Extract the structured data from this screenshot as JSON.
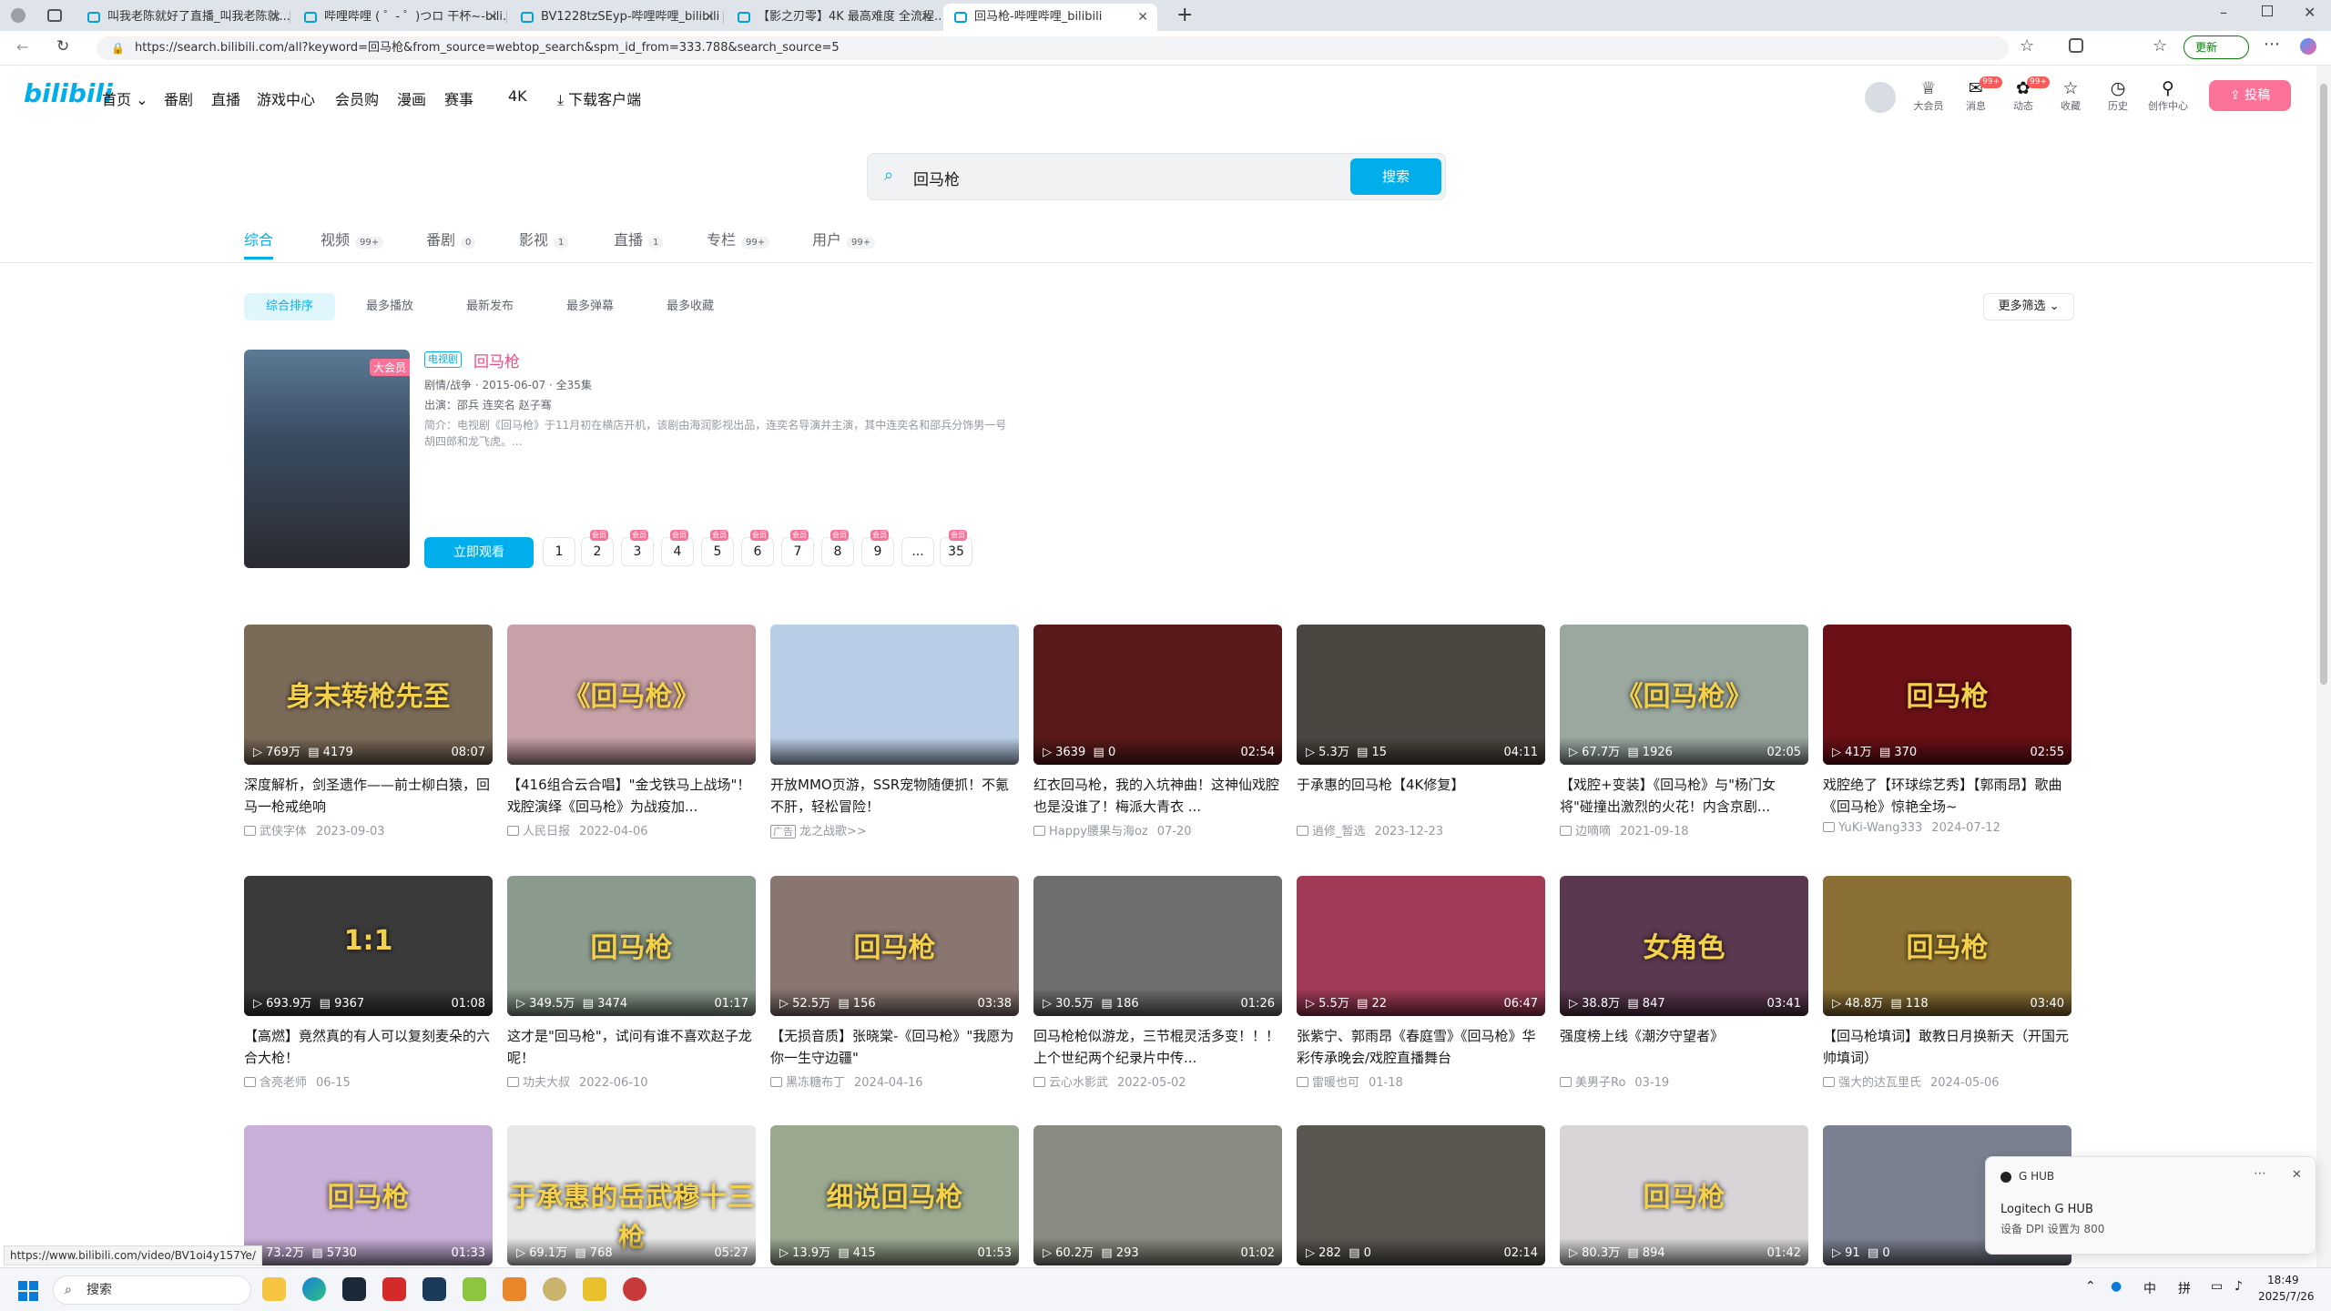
{
  "browser": {
    "tabs": [
      {
        "title": "叫我老陈就好了直播_叫我老陈就..."
      },
      {
        "title": "哔哩哔哩 ( ゜- ゜)つロ 干杯~-bili..."
      },
      {
        "title": "BV1228tzSEyp-哔哩哔哩_bilibili"
      },
      {
        "title": "【影之刃零】4K 最高难度 全流程..."
      },
      {
        "title": "回马枪-哔哩哔哩_bilibili"
      }
    ],
    "url": "https://search.bilibili.com/all?keyword=回马枪&from_source=webtop_search&spm_id_from=333.788&search_source=5",
    "update_label": "更新",
    "status_url": "https://www.bilibili.com/video/BV1oi4y157Ye/"
  },
  "header": {
    "logo": "bilibili",
    "nav": [
      "首页",
      "番剧",
      "直播",
      "游戏中心",
      "会员购",
      "漫画",
      "赛事",
      "4K",
      "下载客户端"
    ],
    "right": [
      {
        "icon": "vip-icon",
        "label": "大会员"
      },
      {
        "icon": "message-icon",
        "label": "消息",
        "badge": "99+"
      },
      {
        "icon": "dynamic-icon",
        "label": "动态",
        "badge": "99+"
      },
      {
        "icon": "star-icon",
        "label": "收藏"
      },
      {
        "icon": "clock-icon",
        "label": "历史"
      },
      {
        "icon": "bulb-icon",
        "label": "创作中心"
      }
    ],
    "upload": "投稿"
  },
  "search": {
    "query": "回马枪",
    "button": "搜索"
  },
  "type_tabs": [
    {
      "label": "综合",
      "count": ""
    },
    {
      "label": "视频",
      "count": "99+"
    },
    {
      "label": "番剧",
      "count": "0"
    },
    {
      "label": "影视",
      "count": "1"
    },
    {
      "label": "直播",
      "count": "1"
    },
    {
      "label": "专栏",
      "count": "99+"
    },
    {
      "label": "用户",
      "count": "99+"
    }
  ],
  "sorts": [
    "综合排序",
    "最多播放",
    "最新发布",
    "最多弹幕",
    "最多收藏"
  ],
  "more_filter": "更多筛选",
  "media": {
    "tag": "电视剧",
    "title": "回马枪",
    "vip": "大会员",
    "info": "剧情/战争 · 2015-06-07 · 全35集",
    "cast": "出演：邵兵 连奕名 赵子骞",
    "desc": "简介：电视剧《回马枪》于11月初在横店开机，该剧由海润影视出品，连奕名导演并主演，其中连奕名和邵兵分饰男一号胡四郎和龙飞虎。...",
    "watch": "立即观看",
    "eps": [
      "1",
      "2",
      "3",
      "4",
      "5",
      "6",
      "7",
      "8",
      "9",
      "...",
      "35"
    ],
    "vipmark": "会员"
  },
  "videos": [
    {
      "title": "深度解析，剑圣遗作——前士柳白猿，回马一枪戒绝响",
      "play": "769万",
      "dm": "4179",
      "dur": "08:07",
      "up": "武侠字体",
      "date": "2023-09-03",
      "overlay": "身末转枪先至",
      "bg": "#7a6a58"
    },
    {
      "title": "【416组合云合唱】\"金戈铁马上战场\"！戏腔演绎《回马枪》为战疫加...",
      "play": "",
      "dm": "",
      "dur": "",
      "up": "人民日报",
      "date": "2022-04-06",
      "overlay": "《回马枪》",
      "bg": "#c8a0a8"
    },
    {
      "title": "开放MMO页游，SSR宠物随便抓！不氪不肝，轻松冒险！",
      "play": "",
      "dm": "",
      "dur": "",
      "up": "龙之战歌>>",
      "date": "",
      "ad": "广告",
      "overlay": "",
      "bg": "#b9cde6"
    },
    {
      "title": "红衣回马枪，我的入坑神曲！这神仙戏腔也是没谁了！梅派大青衣 ...",
      "play": "3639",
      "dm": "0",
      "dur": "02:54",
      "up": "Happy腰果与海oz",
      "date": "07-20",
      "overlay": "",
      "bg": "#5a1a1a"
    },
    {
      "title": "于承惠的回马枪【4K修复】",
      "play": "5.3万",
      "dm": "15",
      "dur": "04:11",
      "up": "逍修_暂选",
      "date": "2023-12-23",
      "overlay": "",
      "bg": "#4a4640"
    },
    {
      "title": "【戏腔+变装】《回马枪》与\"杨门女将\"碰撞出激烈的火花！内含京剧...",
      "play": "67.7万",
      "dm": "1926",
      "dur": "02:05",
      "up": "边嘀嘀",
      "date": "2021-09-18",
      "overlay": "《回马枪》",
      "bg": "#9aa8a0"
    },
    {
      "title": "戏腔绝了【环球综艺秀】【郭雨昂】歌曲《回马枪》惊艳全场~",
      "play": "41万",
      "dm": "370",
      "dur": "02:55",
      "up": "YuKi-Wang333",
      "date": "2024-07-12",
      "overlay": "回马枪",
      "bg": "#6a1016"
    },
    {
      "title": "【高燃】竟然真的有人可以复刻麦朵的六合大枪！",
      "play": "693.9万",
      "dm": "9367",
      "dur": "01:08",
      "up": "含亮老师",
      "date": "06-15",
      "overlay": "1:1",
      "bg": "#3a3a3a"
    },
    {
      "title": "这才是\"回马枪\"，试问有谁不喜欢赵子龙呢！",
      "play": "349.5万",
      "dm": "3474",
      "dur": "01:17",
      "up": "功夫大叔",
      "date": "2022-06-10",
      "overlay": "回马枪",
      "bg": "#8a9a8c"
    },
    {
      "title": "【无损音质】张晓棠-《回马枪》\"我愿为你一生守边疆\"",
      "play": "52.5万",
      "dm": "156",
      "dur": "03:38",
      "up": "黑冻糖布丁",
      "date": "2024-04-16",
      "overlay": "回马枪",
      "bg": "#8a7670"
    },
    {
      "title": "回马枪枪似游龙，三节棍灵活多变！！！上个世纪两个纪录片中传...",
      "play": "30.5万",
      "dm": "186",
      "dur": "01:26",
      "up": "云心水影武",
      "date": "2022-05-02",
      "overlay": "",
      "bg": "#6e6e6e"
    },
    {
      "title": "张紫宁、郭雨昂《春庭雪》《回马枪》华彩传承晚会/戏腔直播舞台",
      "play": "5.5万",
      "dm": "22",
      "dur": "06:47",
      "up": "雷暖也可",
      "date": "01-18",
      "overlay": "",
      "bg": "#a03a56"
    },
    {
      "title": "强度榜上线《潮汐守望者》",
      "play": "38.8万",
      "dm": "847",
      "dur": "03:41",
      "up": "美男子Ro",
      "date": "03-19",
      "overlay": "女角色",
      "bg": "#5a3850"
    },
    {
      "title": "【回马枪填词】敢教日月换新天（开国元帅填词）",
      "play": "48.8万",
      "dm": "118",
      "dur": "03:40",
      "up": "强大的达瓦里氏",
      "date": "2024-05-06",
      "overlay": "回马枪",
      "bg": "#8a7034"
    },
    {
      "title": "",
      "play": "73.2万",
      "dm": "5730",
      "dur": "01:33",
      "up": "",
      "date": "",
      "overlay": "回马枪",
      "bg": "#c8b0d8"
    },
    {
      "title": "",
      "play": "69.1万",
      "dm": "768",
      "dur": "05:27",
      "up": "",
      "date": "",
      "overlay": "于承惠的岳武穆十三枪",
      "bg": "#e8e8e8"
    },
    {
      "title": "",
      "play": "13.9万",
      "dm": "415",
      "dur": "01:53",
      "up": "",
      "date": "",
      "overlay": "细说回马枪",
      "bg": "#9aa890"
    },
    {
      "title": "",
      "play": "60.2万",
      "dm": "293",
      "dur": "01:02",
      "up": "",
      "date": "",
      "overlay": "",
      "bg": "#8a8a80"
    },
    {
      "title": "",
      "play": "282",
      "dm": "0",
      "dur": "02:14",
      "up": "",
      "date": "",
      "overlay": "",
      "bg": "#5a5650"
    },
    {
      "title": "",
      "play": "80.3万",
      "dm": "894",
      "dur": "01:42",
      "up": "",
      "date": "",
      "overlay": "回马枪",
      "bg": "#d8d4d8"
    },
    {
      "title": "",
      "play": "91",
      "dm": "0",
      "dur": "",
      "up": "",
      "date": "",
      "overlay": "",
      "bg": "#7a8090"
    }
  ],
  "toast": {
    "app": "G HUB",
    "title": "Logitech G HUB",
    "body": "设备 DPI 设置为 800"
  },
  "taskbar": {
    "search": "搜索",
    "time": "18:49",
    "date": "2025/7/26",
    "ime": "中",
    "ime2": "拼"
  }
}
